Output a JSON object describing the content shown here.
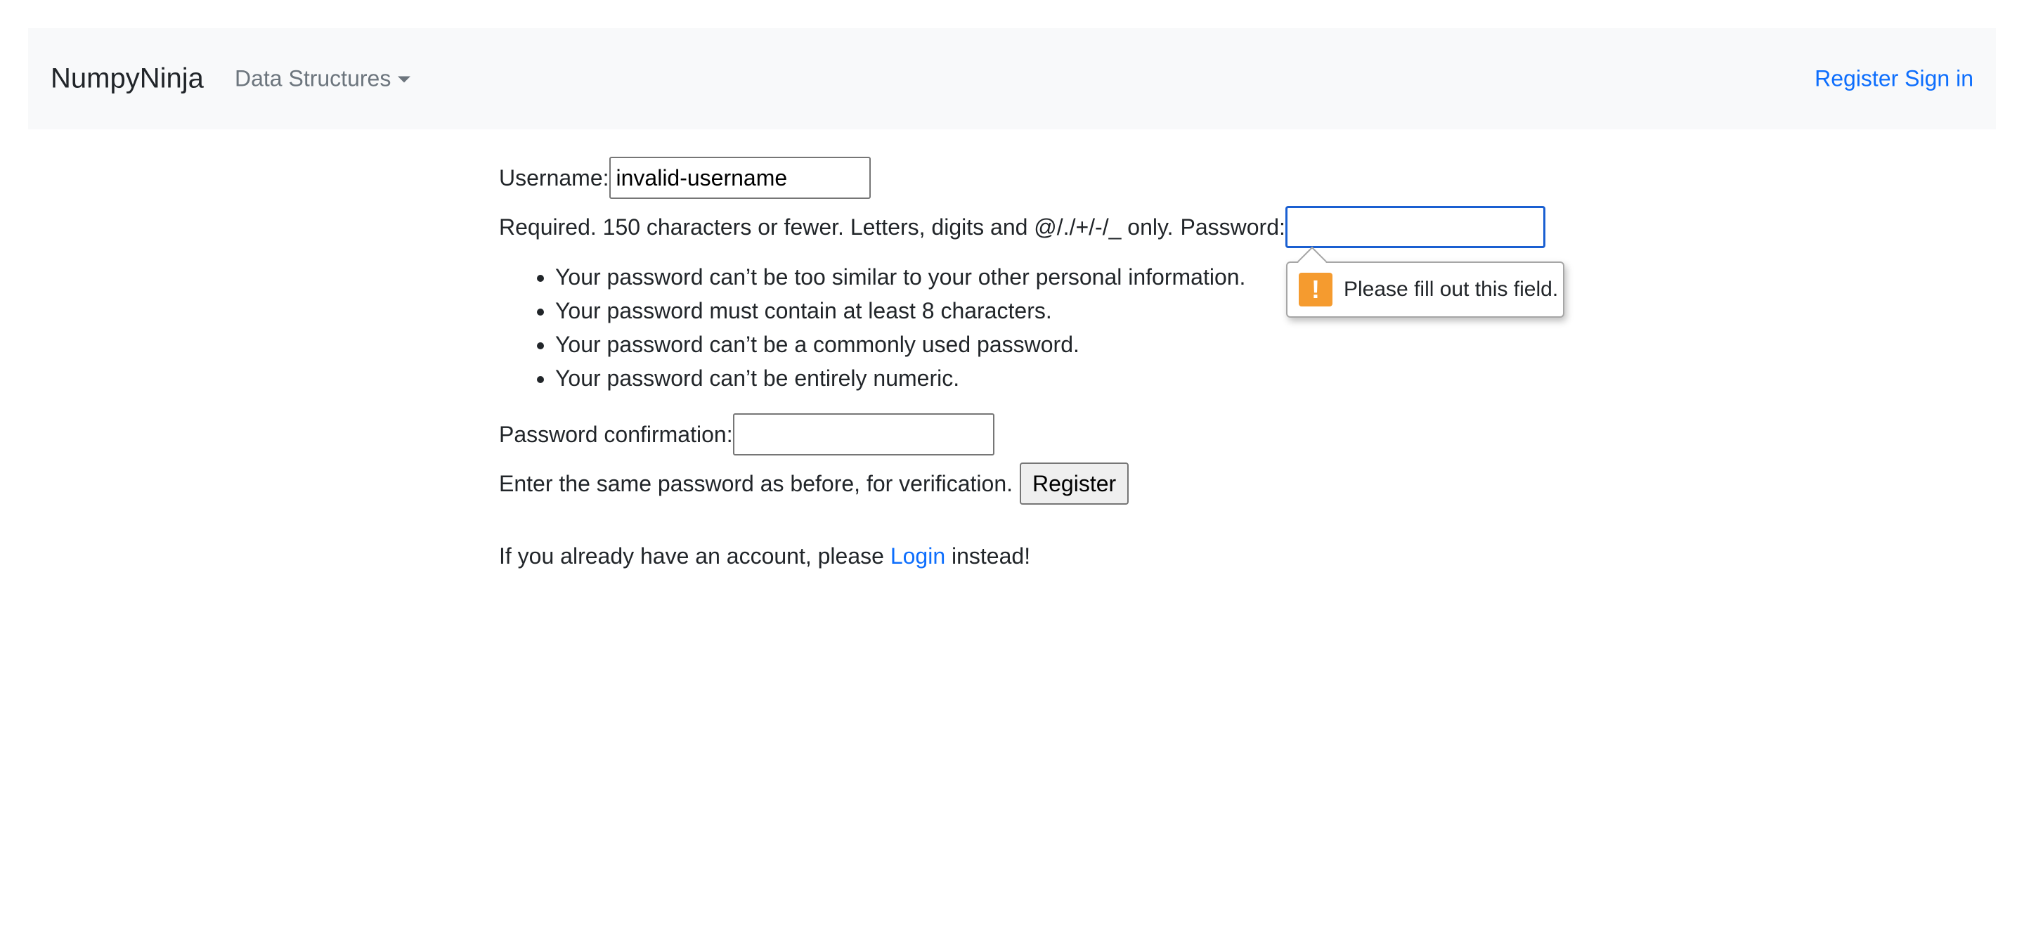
{
  "navbar": {
    "brand": "NumpyNinja",
    "dropdown_label": "Data Structures",
    "register_link": "Register",
    "signin_link": "Sign in",
    "link_color": "#0d6efd"
  },
  "form": {
    "username_label": "Username:",
    "username_value": "invalid-username",
    "username_help": "Required. 150 characters or fewer. Letters, digits and @/./+/-/_ only.",
    "password_label": "Password:",
    "password_value": "",
    "password_help": [
      "Your password can’t be too similar to your other personal information.",
      "Your password must contain at least 8 characters.",
      "Your password can’t be a commonly used password.",
      "Your password can’t be entirely numeric."
    ],
    "password_confirmation_label": "Password confirmation:",
    "password_confirmation_value": "",
    "password_confirmation_help": "Enter the same password as before, for verification.",
    "register_button": "Register"
  },
  "login_prompt": {
    "prefix": "If you already have an account, please",
    "link": "Login",
    "suffix": "instead!"
  },
  "validation_tooltip": {
    "icon": "warning-icon",
    "icon_color": "#f59b2f",
    "message": "Please fill out this field."
  }
}
